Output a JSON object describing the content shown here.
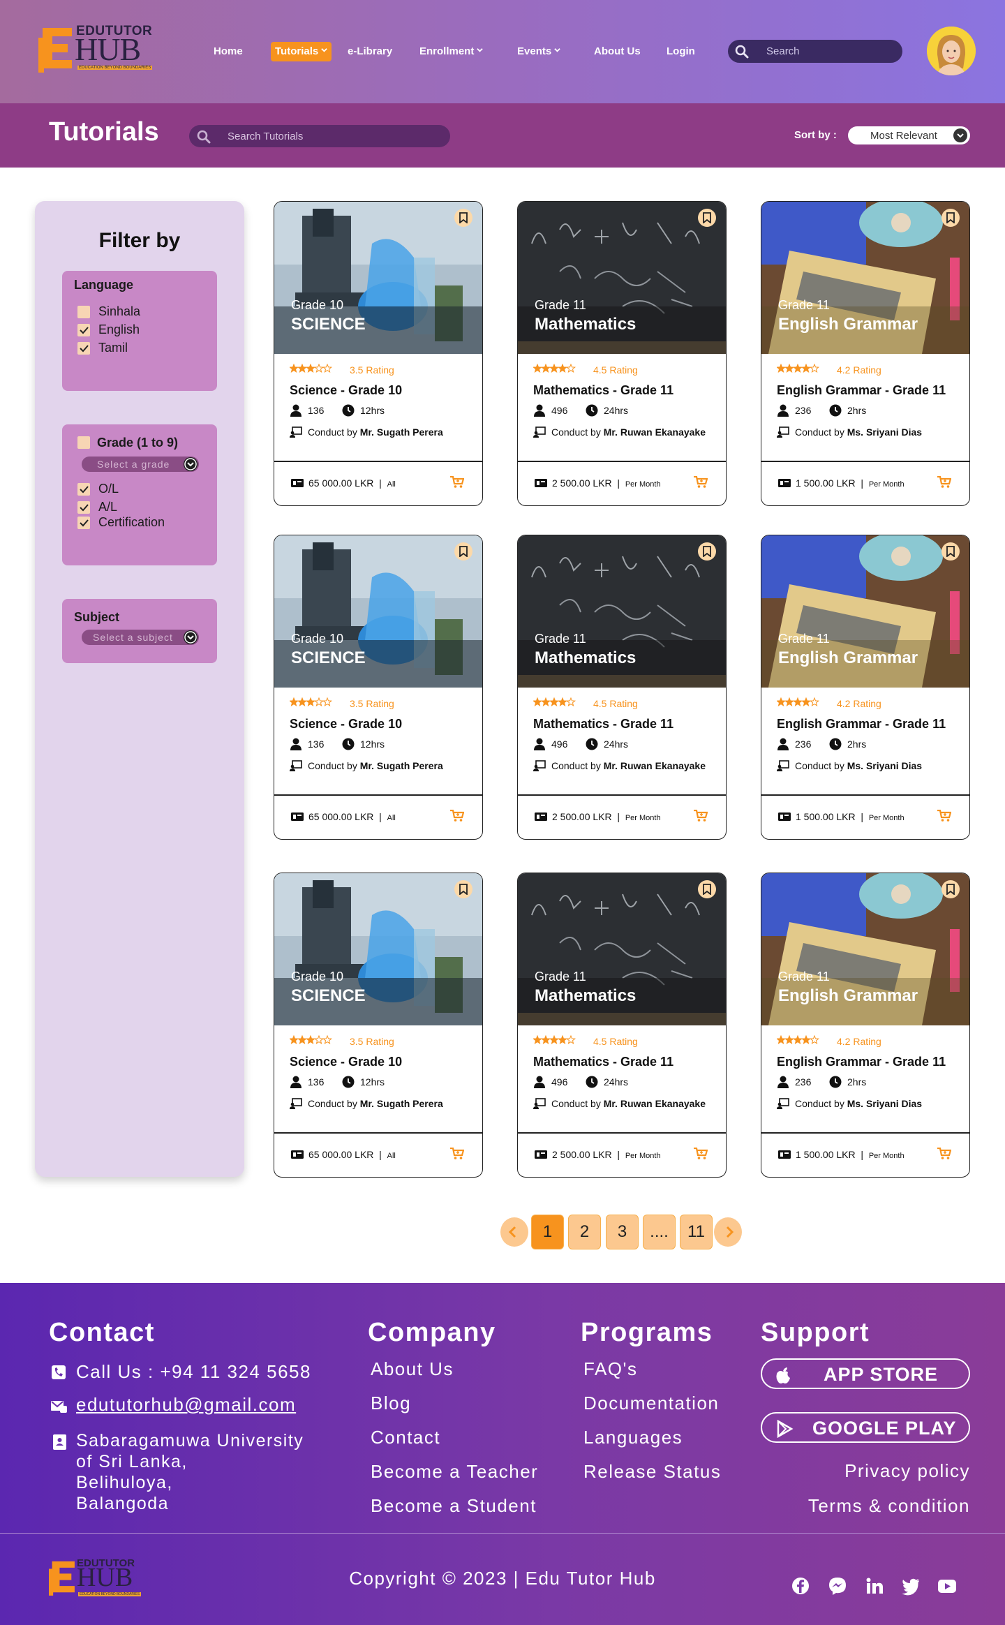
{
  "brand": {
    "logo_line1": "EDUTUTOR",
    "logo_line2": "HUB",
    "logo_tagline": "EDUCATION BEYOND BOUNDARIES"
  },
  "nav": {
    "items": [
      {
        "label": "Home",
        "dropdown": false,
        "active": false
      },
      {
        "label": "Tutorials",
        "dropdown": true,
        "active": true
      },
      {
        "label": "e-Library",
        "dropdown": false,
        "active": false
      },
      {
        "label": "Enrollment",
        "dropdown": true,
        "active": false
      },
      {
        "label": "Events",
        "dropdown": true,
        "active": false
      },
      {
        "label": "About Us",
        "dropdown": false,
        "active": false
      },
      {
        "label": "Login",
        "dropdown": false,
        "active": false
      }
    ],
    "search_placeholder": "Search"
  },
  "titlebar": {
    "title": "Tutorials",
    "search_placeholder": "Search Tutorials",
    "sort_label": "Sort by :",
    "sort_value": "Most Relevant"
  },
  "filters": {
    "heading": "Filter by",
    "language": {
      "title": "Language",
      "options": [
        {
          "label": "Sinhala",
          "checked": false
        },
        {
          "label": "English",
          "checked": true
        },
        {
          "label": "Tamil",
          "checked": true
        }
      ]
    },
    "grade": {
      "title": "Grade (1 to 9)",
      "checked": false,
      "select_placeholder": "Select a grade",
      "options": [
        {
          "label": "O/L",
          "checked": true
        },
        {
          "label": "A/L",
          "checked": true
        },
        {
          "label": "Certification",
          "checked": true
        }
      ]
    },
    "subject": {
      "title": "Subject",
      "select_placeholder": "Select a subject"
    }
  },
  "course_templates": [
    {
      "image": "science-lab",
      "grade": "Grade 10",
      "subject": "SCIENCE",
      "stars": 3,
      "rating": "3.5 Rating",
      "title": "Science - Grade 10",
      "students": "136",
      "hours": "12hrs",
      "conduct_prefix": "Conduct by",
      "teacher": "Mr. Sugath Perera",
      "price": "65 000.00 LKR",
      "period": "All"
    },
    {
      "image": "math-chalkboard",
      "grade": "Grade 11",
      "subject": "Mathematics",
      "stars": 4,
      "rating": "4.5 Rating",
      "title": "Mathematics - Grade 11",
      "students": "496",
      "hours": "24hrs",
      "conduct_prefix": "Conduct by",
      "teacher": "Mr. Ruwan Ekanayake",
      "price": "2 500.00 LKR",
      "period": "Per Month"
    },
    {
      "image": "grammar-book",
      "grade": "Grade 11",
      "subject": "English Grammar",
      "stars": 4,
      "rating": "4.2 Rating",
      "title": "English Grammar - Grade 11",
      "students": "236",
      "hours": "2hrs",
      "conduct_prefix": "Conduct by",
      "teacher": "Ms. Sriyani Dias",
      "price": "1 500.00 LKR",
      "period": "Per Month"
    }
  ],
  "grid": {
    "rows": 3
  },
  "pagination": {
    "pages": [
      "1",
      "2",
      "3",
      "....",
      "11"
    ],
    "current": "1"
  },
  "footer": {
    "contact": {
      "title": "Contact",
      "phone": "Call Us : +94 11 324 5658",
      "email": "edututorhub@gmail.com",
      "address": [
        "Sabaragamuwa University",
        "of Sri Lanka,",
        "Belihuloya,",
        "Balangoda"
      ]
    },
    "company": {
      "title": "Company",
      "links": [
        "About Us",
        "Blog",
        "Contact",
        "Become a Teacher",
        "Become a Student"
      ]
    },
    "programs": {
      "title": "Programs",
      "links": [
        "FAQ's",
        "Documentation",
        "Languages",
        "Release Status"
      ]
    },
    "support": {
      "title": "Support",
      "app_store": "APP STORE",
      "google_play": "GOOGLE PLAY",
      "links": [
        "Privacy policy",
        "Terms & condition"
      ]
    },
    "copyright": "Copyright © 2023 | Edu Tutor Hub",
    "social": [
      "facebook-icon",
      "messenger-icon",
      "linkedin-icon",
      "twitter-icon",
      "youtube-icon"
    ]
  },
  "colors": {
    "accent": "#f7931e",
    "titlebar": "#8e3c86",
    "filter_box": "#c888c6",
    "sidebar": "#e2d4ec"
  }
}
